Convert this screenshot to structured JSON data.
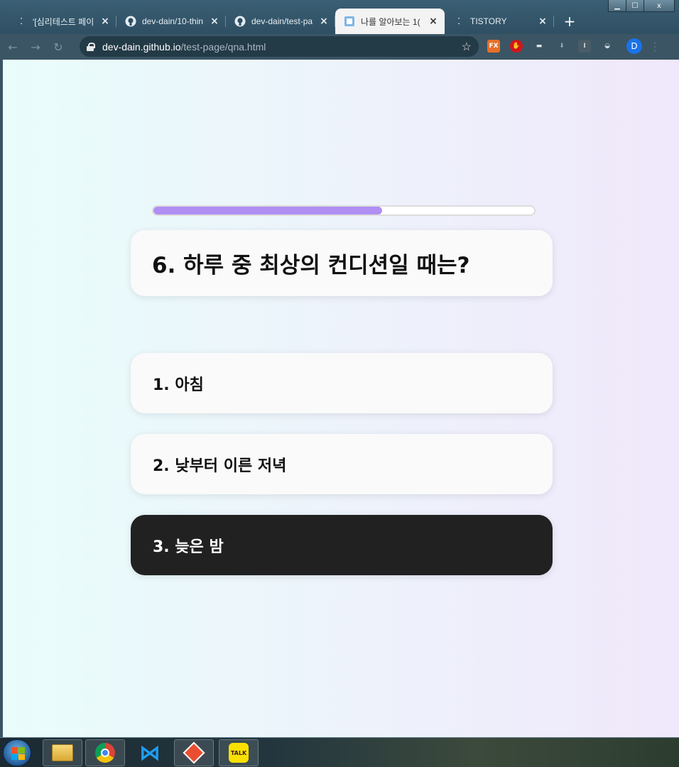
{
  "browser": {
    "tabs": [
      {
        "title": "'[심리테스트 페이",
        "icon": "tistory-icon",
        "active": false
      },
      {
        "title": "dev-dain/10-thin",
        "icon": "github-icon",
        "active": false
      },
      {
        "title": "dev-dain/test-pa",
        "icon": "github-icon",
        "active": false
      },
      {
        "title": "나를 알아보는 1(",
        "icon": "page-icon",
        "active": true
      },
      {
        "title": "TISTORY",
        "icon": "tistory-icon",
        "active": false
      }
    ],
    "close_glyph": "×",
    "new_tab_glyph": "+",
    "url_host": "dev-dain.github.io",
    "url_path": "/test-page/qna.html",
    "profile_initial": "D",
    "window_controls": {
      "minimize": "▁",
      "maximize": "☐",
      "close": "x"
    }
  },
  "quiz": {
    "progress_fraction": 0.6,
    "progress_color": "#b08ef4",
    "question": "6. 하루 중 최상의 컨디션일 때는?",
    "answers": [
      {
        "label": "1. 아침",
        "selected": false
      },
      {
        "label": "2. 낮부터 이른 저녁",
        "selected": false
      },
      {
        "label": "3. 늦은 밤",
        "selected": true
      }
    ]
  },
  "taskbar": {
    "apps": [
      "file-explorer-icon",
      "chrome-icon",
      "vscode-icon",
      "git-icon",
      "kakaotalk-icon"
    ],
    "kakao_label": "TALK"
  }
}
